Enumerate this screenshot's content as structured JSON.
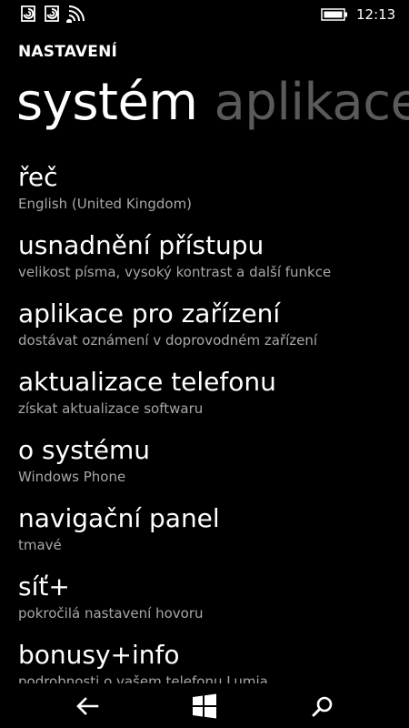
{
  "status_bar": {
    "time": "12:13",
    "icons": [
      "notification-icon",
      "notification-icon",
      "wifi-icon",
      "battery-icon"
    ]
  },
  "header": {
    "section": "NASTAVENÍ"
  },
  "pivot": {
    "tabs": [
      {
        "label": "systém",
        "active": true
      },
      {
        "label": "aplikace",
        "active": false
      }
    ]
  },
  "settings": {
    "items": [
      {
        "title": "řeč",
        "subtitle": "English (United Kingdom)"
      },
      {
        "title": "usnadnění přístupu",
        "subtitle": "velikost písma, vysoký kontrast a další funkce"
      },
      {
        "title": "aplikace pro zařízení",
        "subtitle": "dostávat oznámení v doprovodném zařízení"
      },
      {
        "title": "aktualizace telefonu",
        "subtitle": "získat aktualizace softwaru"
      },
      {
        "title": "o systému",
        "subtitle": "Windows Phone"
      },
      {
        "title": "navigační panel",
        "subtitle": "tmavé"
      },
      {
        "title": "síť+",
        "subtitle": "pokročilá nastavení hovoru"
      },
      {
        "title": "bonusy+info",
        "subtitle": "podrobnosti o vašem telefonu Lumia"
      }
    ]
  },
  "nav_bar": {
    "buttons": [
      "back-icon",
      "windows-start-icon",
      "search-icon"
    ]
  },
  "colors": {
    "background": "#000000",
    "text": "#ffffff",
    "subtext": "#a8a8a8",
    "inactive_pivot": "#5a5a5a"
  }
}
